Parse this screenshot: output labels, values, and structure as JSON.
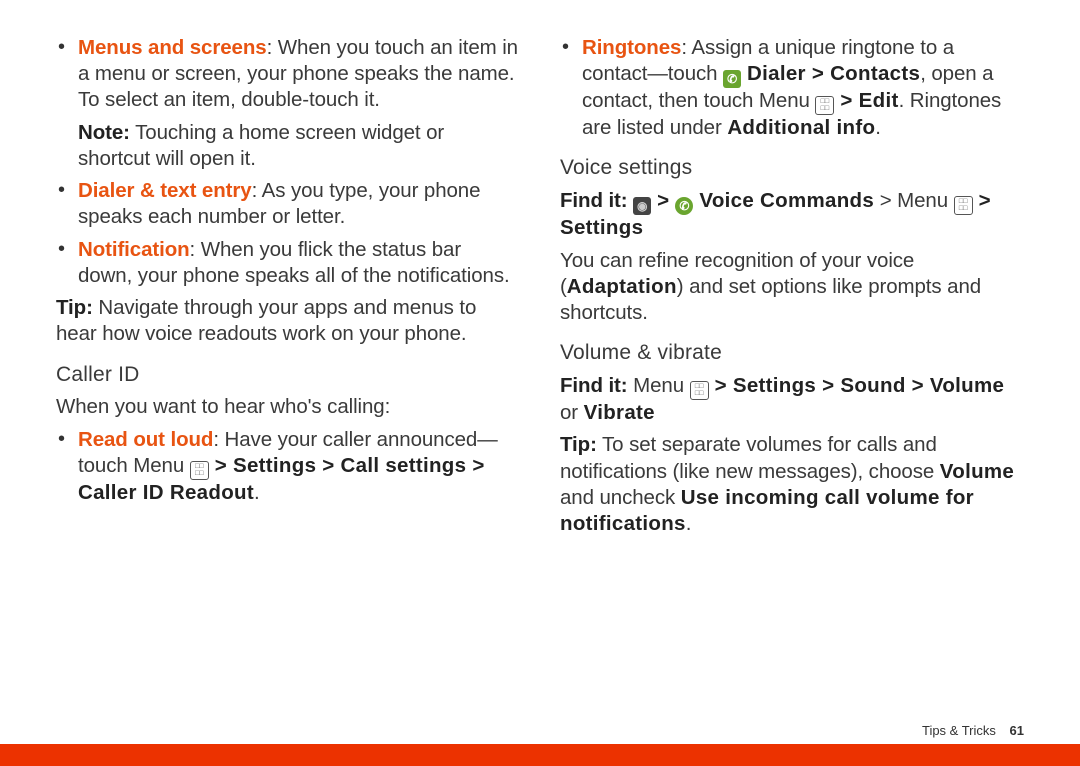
{
  "left": {
    "b1_head": "Menus and screens",
    "b1_body": ": When you touch an item in a menu or screen, your phone speaks the name. To select an item, double-touch it.",
    "note_label": "Note:",
    "note_body": " Touching a home screen widget or shortcut will open it.",
    "b2_head": "Dialer & text entry",
    "b2_body": ": As you type, your phone speaks each number or letter.",
    "b3_head": "Notification",
    "b3_body": ": When you flick the status bar down, your phone speaks all of the notifications.",
    "tip_label": "Tip:",
    "tip_body": " Navigate through your apps and menus to hear how voice readouts work on your phone.",
    "h1": "Caller ID",
    "p1": "When you want to hear who's calling:",
    "b4_head": "Read out loud",
    "b4_body1": ": Have your caller announced—touch Menu ",
    "b4_path": " > Settings > Call settings > Caller ID Readout"
  },
  "right": {
    "b5_head": "Ringtones",
    "b5_a": ": Assign a unique ringtone to a contact—touch ",
    "b5_path1": " Dialer > Contacts",
    "b5_b": ", open a contact, then touch Menu ",
    "b5_edit": " > Edit",
    "b5_c": ". Ringtones are listed under ",
    "b5_addl": "Additional info",
    "h2": "Voice settings",
    "findit": "Find it:",
    "vs_path1": " > ",
    "vs_path2": " Voice Commands",
    "vs_path3": " > Menu ",
    "vs_path4": " > Settings",
    "vs_body_a": "You can refine recognition of your voice (",
    "vs_adapt": "Adaptation",
    "vs_body_b": ") and set options like prompts and shortcuts.",
    "h3": "Volume & vibrate",
    "vv_a": " Menu ",
    "vv_path": " > Settings > Sound > Volume",
    "vv_or": " or ",
    "vv_vib": "Vibrate",
    "tip2_label": "Tip:",
    "tip2_a": " To set separate volumes for calls and notifications (like new messages), choose ",
    "tip2_vol": "Volume",
    "tip2_b": " and uncheck ",
    "tip2_use": "Use incoming call volume for notifications"
  },
  "footer": {
    "section": "Tips & Tricks",
    "page": "61"
  }
}
